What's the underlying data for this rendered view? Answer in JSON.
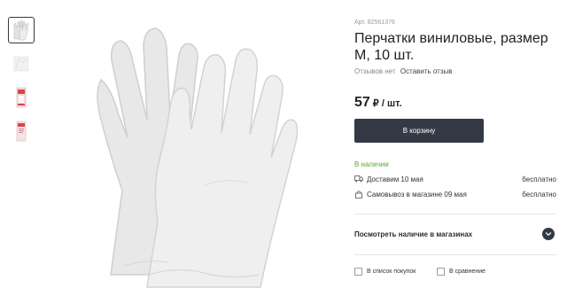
{
  "product": {
    "sku": "Арт. 82561376",
    "title": "Перчатки виниловые, размер М, 10 шт.",
    "reviews_status": "Отзывов нет",
    "write_review": "Оставить отзыв",
    "price": "57",
    "price_unit": "₽ / шт.",
    "add_to_cart": "В корзину"
  },
  "availability": {
    "in_stock": "В наличии",
    "delivery_label": "Доставим 10 мая",
    "delivery_price": "бесплатно",
    "pickup_label": "Самовывоз в магазине 09 мая",
    "pickup_price": "бесплатно",
    "stores_label": "Посмотреть наличие в магазинах"
  },
  "actions": {
    "shopping_list": "В список покупок",
    "compare": "В сравнение"
  },
  "gallery": {
    "thumbnails": [
      "gloves-photo",
      "gloves-closeup",
      "package-front",
      "package-back"
    ],
    "active_index": 0
  },
  "colors": {
    "accent": "#333a45",
    "in_stock": "#5aa832"
  },
  "icons": [
    "truck-icon",
    "bag-icon",
    "chevron-down-icon",
    "checkbox-icon"
  ]
}
